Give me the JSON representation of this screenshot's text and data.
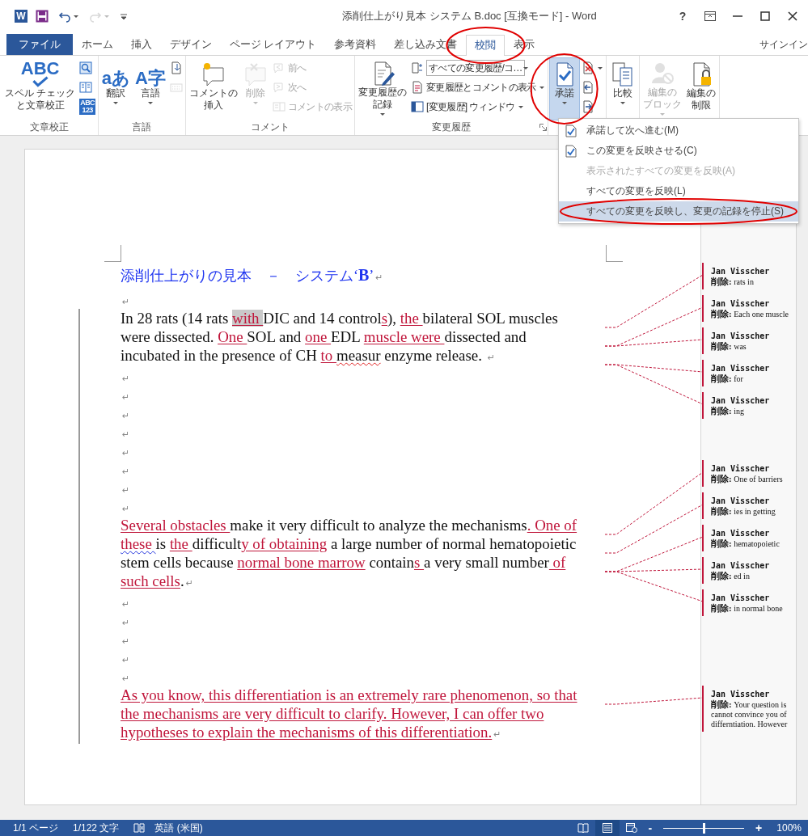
{
  "window": {
    "title": "添削仕上がり見本 システム B.doc [互換モード] - Word",
    "help": "?"
  },
  "quick_access": [
    {
      "kind": "app",
      "glyph": "W"
    },
    {
      "kind": "save"
    },
    {
      "kind": "undo"
    },
    {
      "kind": "redo",
      "disabled": true
    },
    {
      "kind": "customize"
    }
  ],
  "tabs": [
    {
      "label": "ファイル",
      "kind": "file",
      "selected": false
    },
    {
      "label": "ホーム",
      "kind": "tab",
      "selected": false
    },
    {
      "label": "挿入",
      "kind": "tab",
      "selected": false
    },
    {
      "label": "デザイン",
      "kind": "tab",
      "selected": false
    },
    {
      "label": "ページ レイアウト",
      "kind": "tab",
      "selected": false
    },
    {
      "label": "参考資料",
      "kind": "tab",
      "selected": false
    },
    {
      "label": "差し込み文書",
      "kind": "tab",
      "selected": false
    },
    {
      "label": "校閲",
      "kind": "tab",
      "selected": true,
      "circled": true
    },
    {
      "label": "表示",
      "kind": "tab",
      "selected": false
    }
  ],
  "account": {
    "label": "サインイン"
  },
  "ribbon": {
    "groups": [
      {
        "label": "文章校正",
        "buttons": [
          {
            "kind": "large",
            "glyph": "ABC",
            "lines": [
              "スペル チェック",
              "と文章校正"
            ],
            "disabled": false
          },
          {
            "kind": "icon",
            "disabled": false
          },
          {
            "kind": "icon",
            "disabled": false
          },
          {
            "kind": "icon",
            "glyph": "ABC\n123",
            "disabled": false
          }
        ]
      },
      {
        "label": "言語",
        "buttons": [
          {
            "kind": "large",
            "glyph": "aあ",
            "lines": [
              "翻訳"
            ],
            "disabled": false,
            "caret": true
          },
          {
            "kind": "large",
            "glyph": "A字",
            "lines": [
              "言語"
            ],
            "disabled": false,
            "caret": true
          },
          {
            "kind": "icon",
            "disabled": false
          },
          {
            "kind": "icon",
            "disabled": true
          }
        ]
      },
      {
        "label": "コメント",
        "buttons": [
          {
            "kind": "large",
            "lines": [
              "コメントの",
              "挿入"
            ],
            "disabled": false
          },
          {
            "kind": "large",
            "lines": [
              "削除"
            ],
            "disabled": true,
            "caret": true
          },
          {
            "kind": "small",
            "label": "前へ",
            "disabled": true
          },
          {
            "kind": "small",
            "label": "次へ",
            "disabled": true
          },
          {
            "kind": "small",
            "label": "コメントの表示",
            "disabled": true
          }
        ]
      },
      {
        "label": "変更履歴",
        "launcher": true,
        "buttons": [
          {
            "kind": "large",
            "lines": [
              "変更履歴の",
              "記録"
            ],
            "disabled": false,
            "caret": true
          },
          {
            "kind": "select",
            "label": "すべての変更履歴/コ…",
            "disabled": false,
            "caret": true
          },
          {
            "kind": "small",
            "label": "変更履歴とコメントの表示",
            "disabled": false,
            "caret": true
          },
          {
            "kind": "small",
            "label": "[変更履歴] ウィンドウ",
            "disabled": false,
            "caret": true
          }
        ]
      },
      {
        "buttons": [
          {
            "kind": "large",
            "lines": [
              "承諾"
            ],
            "disabled": false,
            "caret": true,
            "pressed": true,
            "circled": true
          },
          {
            "kind": "icon",
            "disabled": false,
            "caret": true
          },
          {
            "kind": "icon",
            "disabled": false
          },
          {
            "kind": "icon",
            "disabled": false
          }
        ]
      },
      {
        "buttons": [
          {
            "kind": "large",
            "lines": [
              "比較"
            ],
            "disabled": false,
            "caret": true
          }
        ]
      },
      {
        "buttons": [
          {
            "kind": "large",
            "lines": [
              "編集の",
              "ブロック"
            ],
            "disabled": true,
            "caret": true
          },
          {
            "kind": "large",
            "lines": [
              "編集の",
              "制限"
            ],
            "disabled": false
          }
        ]
      }
    ]
  },
  "menu": {
    "items": [
      {
        "label": "承諾して次へ進む(M)",
        "kind": "check",
        "disabled": false,
        "selected": false
      },
      {
        "label": "この変更を反映させる(C)",
        "kind": "check",
        "disabled": false,
        "selected": false
      },
      {
        "label": "表示されたすべての変更を反映(A)",
        "kind": "plain",
        "disabled": true,
        "selected": false
      },
      {
        "label": "すべての変更を反映(L)",
        "kind": "plain",
        "disabled": false,
        "selected": false
      },
      {
        "label": "すべての変更を反映し、変更の記録を停止(S)",
        "kind": "plain",
        "disabled": false,
        "selected": true,
        "circled": true
      }
    ]
  },
  "document": {
    "blocks": [
      {
        "paragraphs": [
          {
            "kind": "heading",
            "changed": false,
            "text": "添削仕上がりの見本　－　システム‘**B**’",
            "mark": "↵"
          },
          {
            "kind": "empty",
            "changed": false,
            "mark": "↵"
          },
          {
            "kind": "body",
            "changed": true,
            "mark": "↵",
            "runs": [
              {
                "text": "In 28 rats (14 rats ",
                "kind": "plain"
              },
              {
                "text": "with ",
                "kind": "insert-shaded",
                "balloon": true
              },
              {
                "text": "DIC and 14 control",
                "kind": "plain"
              },
              {
                "text": "s",
                "kind": "insert"
              },
              {
                "text": "), ",
                "kind": "plain"
              },
              {
                "text": "the ",
                "kind": "insert"
              },
              {
                "text": "bilateral SOL muscles were dissected. ",
                "kind": "plain"
              },
              {
                "text": "One ",
                "kind": "insert",
                "balloon": true
              },
              {
                "text": "SOL and ",
                "kind": "plain"
              },
              {
                "text": "one ",
                "kind": "insert"
              },
              {
                "text": "EDL ",
                "kind": "plain"
              },
              {
                "text": "muscle were ",
                "kind": "insert",
                "balloon": true
              },
              {
                "text": "dissected and incubated in the presence of CH ",
                "kind": "plain"
              },
              {
                "text": "to ",
                "kind": "insert",
                "balloon": true
              },
              {
                "text": "measur",
                "kind": "misspelt",
                "balloon": true
              },
              {
                "text": " enzyme release. ",
                "kind": "plain"
              }
            ]
          },
          {
            "kind": "empty",
            "changed": true,
            "mark": "↵"
          },
          {
            "kind": "empty",
            "changed": true,
            "mark": "↵"
          },
          {
            "kind": "empty",
            "changed": true,
            "mark": "↵"
          },
          {
            "kind": "empty",
            "changed": true,
            "mark": "↵"
          },
          {
            "kind": "empty",
            "changed": true,
            "mark": "↵"
          }
        ],
        "balloons": [
          {
            "author": "Jan Visscher",
            "text": "**削除:** rats in"
          },
          {
            "author": "Jan Visscher",
            "text": "**削除:** Each one muscle"
          },
          {
            "author": "Jan Visscher",
            "text": "**削除:** was"
          },
          {
            "author": "Jan Visscher",
            "text": "**削除:** for"
          },
          {
            "author": "Jan Visscher",
            "text": "**削除:** ing"
          }
        ]
      },
      {
        "paragraphs": [
          {
            "kind": "empty",
            "changed": true,
            "mark": "↵"
          },
          {
            "kind": "empty",
            "changed": true,
            "mark": "↵"
          },
          {
            "kind": "empty",
            "changed": true,
            "mark": "↵"
          },
          {
            "kind": "body",
            "changed": true,
            "mark": "↵",
            "runs": [
              {
                "text": "Several obstacles ",
                "kind": "insert",
                "balloon": true
              },
              {
                "text": "make it very difficult to analyze the mechanisms",
                "kind": "plain"
              },
              {
                "text": ". One of ",
                "kind": "insert"
              },
              {
                "text": "these ",
                "kind": "insert-grammar"
              },
              {
                "text": " is ",
                "kind": "plain"
              },
              {
                "text": "the ",
                "kind": "insert"
              },
              {
                "text": "difficult",
                "kind": "plain"
              },
              {
                "text": "y of obtaining",
                "kind": "insert",
                "balloon": true
              },
              {
                "text": " a large number of normal hematopoietic stem cells because ",
                "kind": "plain"
              },
              {
                "text": "normal bone marrow",
                "kind": "insert",
                "balloon": true
              },
              {
                "text": " contain",
                "kind": "plain"
              },
              {
                "text": "s ",
                "kind": "insert",
                "balloon": true
              },
              {
                "text": "a very small number",
                "kind": "plain"
              },
              {
                "text": " of such cells",
                "kind": "insert",
                "balloon": true
              },
              {
                "text": ".",
                "kind": "plain"
              }
            ]
          },
          {
            "kind": "empty",
            "changed": true,
            "mark": "↵"
          },
          {
            "kind": "empty",
            "changed": true,
            "mark": "↵"
          },
          {
            "kind": "empty",
            "changed": true,
            "mark": "↵"
          },
          {
            "kind": "empty",
            "changed": true,
            "mark": "↵"
          },
          {
            "kind": "empty",
            "changed": true,
            "mark": "↵"
          }
        ],
        "balloons": [
          {
            "author": "Jan Visscher",
            "text": "**削除:** One of barriers"
          },
          {
            "author": "Jan Visscher",
            "text": "**削除:** ies in getting"
          },
          {
            "author": "Jan Visscher",
            "text": "**削除:** hematopoietic"
          },
          {
            "author": "Jan Visscher",
            "text": "**削除:** ed in"
          },
          {
            "author": "Jan Visscher",
            "text": "**削除:** in normal bone"
          }
        ]
      },
      {
        "paragraphs": [
          {
            "kind": "body",
            "changed": true,
            "mark": "↵",
            "runs": [
              {
                "text": "As you know, this differentiation is an extremely rare phenomenon, so that the mechanisms are very difficult to clarify. However, I can offer two hypotheses to explain the mechanisms of this differentiation.",
                "kind": "insert",
                "balloon": true
              }
            ]
          }
        ],
        "balloons": [
          {
            "author": "Jan Visscher",
            "text": "**削除:** Your question is cannot convince you of differntiation. However"
          }
        ]
      }
    ]
  },
  "status_bar": {
    "items": [
      {
        "kind": "text",
        "label": "1/1 ページ"
      },
      {
        "kind": "text",
        "label": "1/122 文字"
      },
      {
        "kind": "proofing"
      },
      {
        "kind": "text",
        "label": "英語 (米国)"
      }
    ],
    "views": [
      {
        "kind": "read",
        "selected": false
      },
      {
        "kind": "print",
        "selected": true
      },
      {
        "kind": "web",
        "selected": false
      }
    ],
    "zoom": {
      "minus": "-",
      "plus": "+",
      "level": 0.5,
      "reading": "100%"
    }
  }
}
